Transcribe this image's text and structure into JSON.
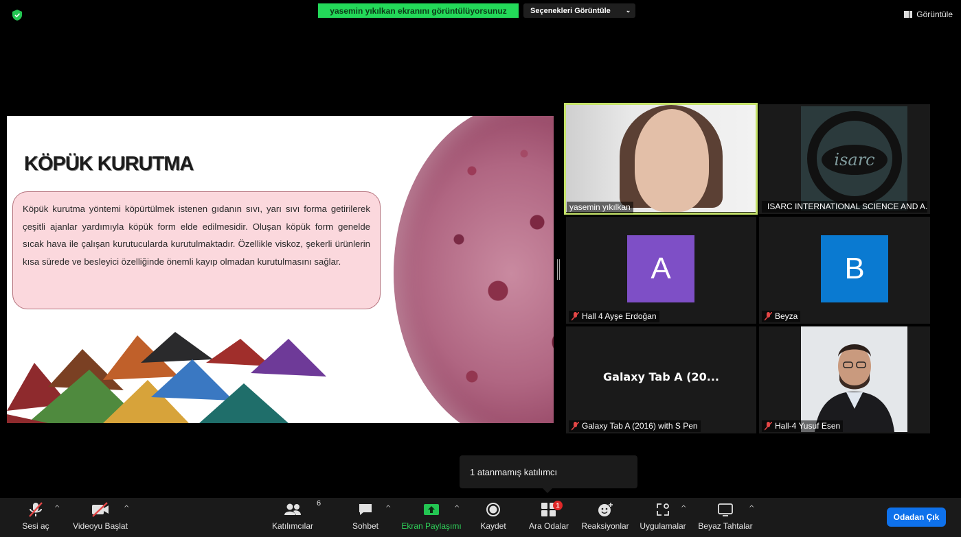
{
  "top": {
    "share_banner": "yasemin yıkılkan ekranını görüntülüyorsunuz",
    "options_label": "Seçenekleri Görüntüle",
    "view_label": "Görüntüle"
  },
  "slide": {
    "title": "KÖPÜK KURUTMA",
    "body": "Köpük kurutma yöntemi köpürtülmek istenen gıdanın sıvı, yarı sıvı forma getirilerek çeşitli ajanlar yardımıyla köpük form elde edilmesidir. Oluşan köpük form genelde sıcak hava ile çalışan kurutucularda kurutulmaktadır. Özellikle viskoz, şekerli ürünlerin kısa sürede ve besleyici özelliğinde önemli kayıp olmadan kurutulmasını sağlar."
  },
  "participants": [
    {
      "name": "yasemin yıkılkan",
      "muted": false
    },
    {
      "name": "ISARC INTERNATIONAL SCIENCE AND A...",
      "muted": true,
      "logo_text": "isarc"
    },
    {
      "name": "Hall 4 Ayşe Erdoğan",
      "muted": true,
      "initial": "A",
      "color": "#7e4fc6"
    },
    {
      "name": "Beyza",
      "muted": true,
      "initial": "B",
      "color": "#0a7ad1"
    },
    {
      "name": "Galaxy Tab A (2016) with S Pen",
      "muted": true,
      "big_label": "Galaxy Tab A (20..."
    },
    {
      "name": "Hall-4 Yusuf Esen",
      "muted": true
    }
  ],
  "tooltip": "1 atanmamış katılımcı",
  "toolbar": {
    "unmute": "Sesi aç",
    "start_video": "Videoyu Başlat",
    "participants": "Katılımcılar",
    "participants_count": "6",
    "chat": "Sohbet",
    "share_screen": "Ekran Paylaşımı",
    "record": "Kaydet",
    "breakout": "Ara Odalar",
    "breakout_badge": "1",
    "reactions": "Reaksiyonlar",
    "apps": "Uygulamalar",
    "whiteboards": "Beyaz Tahtalar",
    "leave": "Odadan Çık"
  },
  "colors": {
    "accent_green": "#23d959",
    "leave_blue": "#0e71eb",
    "active_border": "#c5e26a",
    "badge_red": "#e02828"
  }
}
